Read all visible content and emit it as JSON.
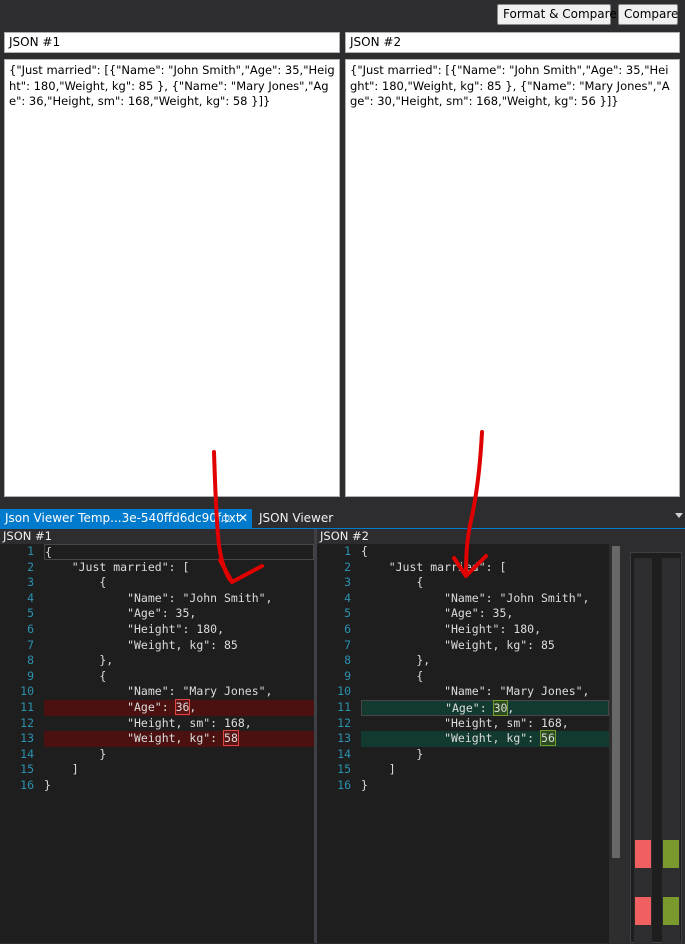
{
  "toolbar": {
    "format_compare_label": "Format & Compare",
    "compare_label": "Compare"
  },
  "inputs": {
    "left": {
      "label": "JSON #1",
      "value": "{\"Just married\": [{\"Name\": \"John Smith\",\"Age\": 35,\"Height\": 180,\"Weight, kg\": 85 }, {\"Name\": \"Mary Jones\",\"Age\": 36,\"Height, sm\": 168,\"Weight, kg\": 58 }]}"
    },
    "right": {
      "label": "JSON #2",
      "value": "{\"Just married\": [{\"Name\": \"John Smith\",\"Age\": 35,\"Height\": 180,\"Weight, kg\": 85 }, {\"Name\": \"Mary Jones\",\"Age\": 30,\"Height, sm\": 168,\"Weight, kg\": 56 }]}"
    }
  },
  "tabs": {
    "active_label": "Json Viewer Temp...3e-540ffd6dc90f.txt",
    "inactive_label": "JSON Viewer",
    "close_glyph": "✕",
    "pin_glyph": "ф"
  },
  "left_pane": {
    "title": "JSON #1",
    "lines": [
      "{",
      "    \"Just married\": [",
      "        {",
      "            \"Name\": \"John Smith\",",
      "            \"Age\": 35,",
      "            \"Height\": 180,",
      "            \"Weight, kg\": 85",
      "        },",
      "        {",
      "            \"Name\": \"Mary Jones\",",
      "            \"Age\": 36,",
      "            \"Height, sm\": 168,",
      "            \"Weight, kg\": 58",
      "        }",
      "    ]",
      "}"
    ],
    "diff_values": {
      "11": "36",
      "13": "58"
    }
  },
  "right_pane": {
    "title": "JSON #2",
    "lines": [
      "{",
      "    \"Just married\": [",
      "        {",
      "            \"Name\": \"John Smith\",",
      "            \"Age\": 35,",
      "            \"Height\": 180,",
      "            \"Weight, kg\": 85",
      "        },",
      "        {",
      "            \"Name\": \"Mary Jones\",",
      "            \"Age\": 30,",
      "            \"Height, sm\": 168,",
      "            \"Weight, kg\": 56",
      "        }",
      "    ]",
      "}"
    ],
    "diff_values": {
      "11": "30",
      "13": "56"
    }
  },
  "diff_lines": [
    11,
    13
  ],
  "colors": {
    "deleted_line": "#4b1010",
    "inserted_line": "#123a30",
    "minimap_deleted": "#f06060",
    "minimap_inserted": "#7a9a2e",
    "annotation_arrow": "#e00000",
    "tab_active": "#007acc"
  },
  "icons": {
    "tab_overflow": "chevron-down-icon"
  }
}
